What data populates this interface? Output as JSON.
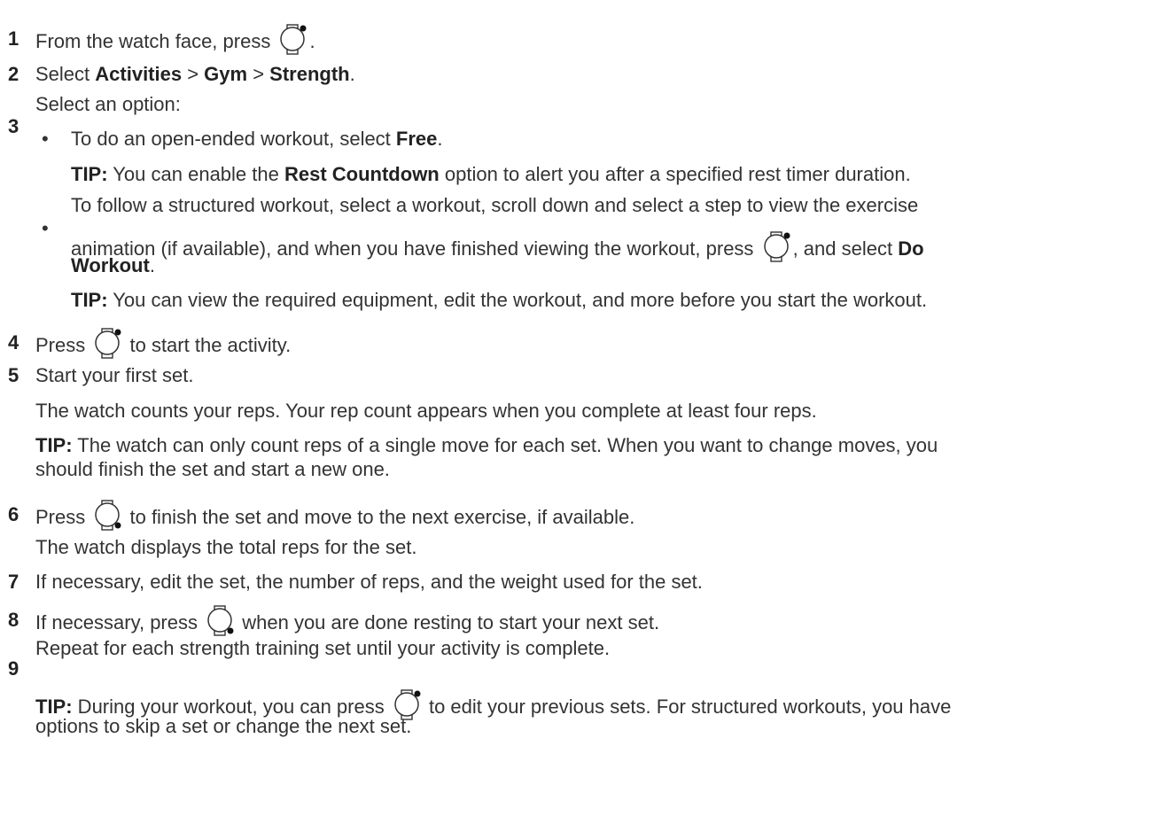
{
  "steps": [
    {
      "num": "1",
      "parts": {
        "a": "From the watch face, press",
        "b": "."
      }
    },
    {
      "num": "2",
      "parts": {
        "a": "Select ",
        "b1": "Activities",
        "sep1": " > ",
        "b2": "Gym",
        "sep2": " > ",
        "b3": "Strength",
        "end": "."
      }
    },
    {
      "num": "3",
      "intro": "Select an option:",
      "bullet1": {
        "a": "To do an open-ended workout, select ",
        "b": "Free",
        "end": "."
      },
      "tip1": {
        "label": "TIP:",
        "a": " You can enable the ",
        "b": "Rest Countdown",
        "c": " option to alert you after a specified rest timer duration."
      },
      "bullet2": {
        "line1": "To follow a structured workout, select a workout, scroll down and select a step to view the exercise",
        "line2a": "animation (if available), and when you have finished viewing the workout, press",
        "line2b": ", and select ",
        "line2c": "Do",
        "line3": "Workout",
        "line3end": "."
      },
      "tip2": {
        "label": "TIP:",
        "a": " You can view the required equipment, edit the workout, and more before you start the workout."
      }
    },
    {
      "num": "4",
      "parts": {
        "a": "Press",
        "b": " to start the activity."
      }
    },
    {
      "num": "5",
      "parts": {
        "a": "Start your first set."
      },
      "para": "The watch counts your reps. Your rep count appears when you complete at least four reps.",
      "tip": {
        "label": "TIP:",
        "line1": " The watch can only count reps of a single move for each set. When you want to change moves, you",
        "line2": "should finish the set and start a new one."
      }
    },
    {
      "num": "6",
      "parts": {
        "a": "Press",
        "b": " to finish the set and move to the next exercise, if available."
      },
      "para": "The watch displays the total reps for the set."
    },
    {
      "num": "7",
      "parts": {
        "a": "If necessary, edit the set, the number of reps, and the weight used for the set."
      }
    },
    {
      "num": "8",
      "parts": {
        "a": "If necessary, press",
        "b": " when you are done resting to start your next set."
      }
    },
    {
      "num": "9",
      "parts": {
        "a": "Repeat for each strength training set until your activity is complete."
      },
      "tip": {
        "label": "TIP:",
        "a": " During your workout, you can press",
        "b": " to edit your previous sets. For structured workouts, you have",
        "line2": "options to skip a set or change the next set."
      }
    }
  ],
  "icons": {
    "top_button": "watch-top-button-icon",
    "bottom_button": "watch-bottom-button-icon"
  }
}
